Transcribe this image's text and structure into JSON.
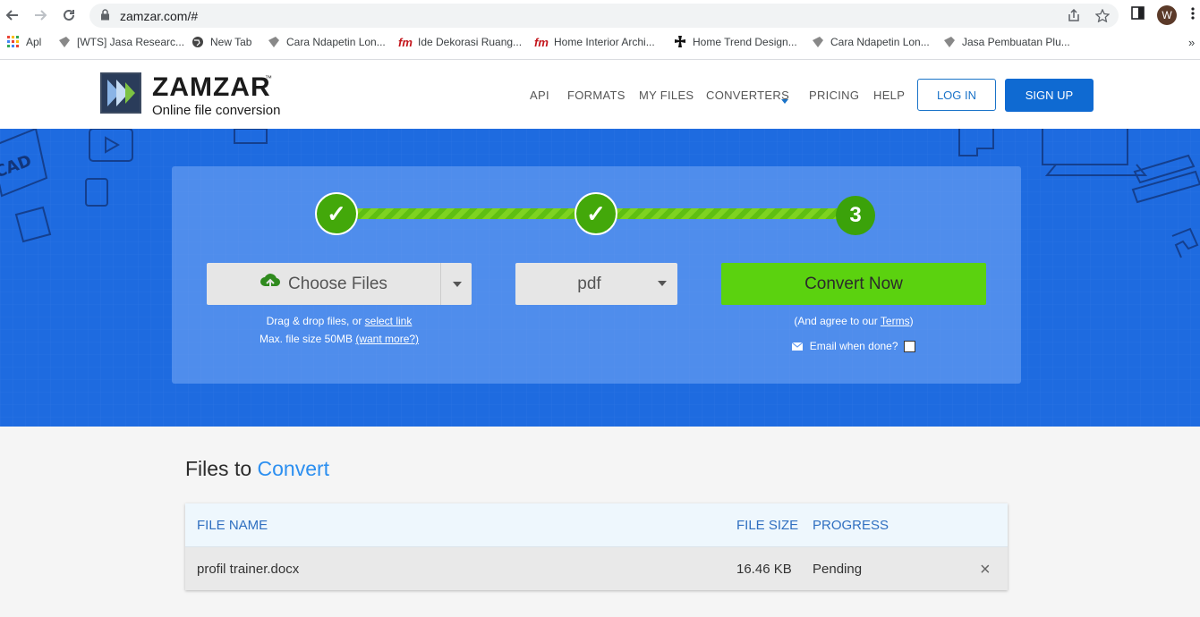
{
  "browser": {
    "url": "zamzar.com/#",
    "avatar_letter": "W",
    "bookmarks": [
      {
        "label": "Apl",
        "icon": "apps-grid-icon"
      },
      {
        "label": "[WTS] Jasa Researc...",
        "icon": "bookmark-site-icon"
      },
      {
        "label": "New Tab",
        "icon": "globe-icon"
      },
      {
        "label": "Cara Ndapetin Lon...",
        "icon": "bookmark-site-icon"
      },
      {
        "label": "Ide Dekorasi Ruang...",
        "icon": "fm-icon"
      },
      {
        "label": "Home Interior Archi...",
        "icon": "fm-icon"
      },
      {
        "label": "Home Trend Design...",
        "icon": "cross-icon"
      },
      {
        "label": "Cara Ndapetin Lon...",
        "icon": "bookmark-site-icon"
      },
      {
        "label": "Jasa Pembuatan Plu...",
        "icon": "bookmark-site-icon"
      }
    ],
    "more_bookmarks": "»"
  },
  "header": {
    "logo_word": "ZAMZAR",
    "logo_tm": "™",
    "logo_sub": "Online file conversion",
    "nav": [
      "API",
      "FORMATS",
      "MY FILES",
      "CONVERTERS",
      "PRICING",
      "HELP"
    ],
    "login_label": "LOG IN",
    "signup_label": "SIGN UP"
  },
  "converter": {
    "step1_mark": "✓",
    "step2_mark": "✓",
    "step3_label": "3",
    "choose_files_label": "Choose Files",
    "drag_text": "Drag & drop files, or ",
    "select_link": "select link",
    "max_size_text": "Max. file size 50MB ",
    "want_more": "(want more?)",
    "format_value": "pdf",
    "convert_label": "Convert Now",
    "agree_text": "(And agree to our ",
    "terms_link": "Terms",
    "agree_close": ")",
    "email_label": "Email when done?",
    "hero_deco_text": "CAD"
  },
  "files": {
    "title_plain": "Files to ",
    "title_accent": "Convert",
    "headers": {
      "name": "FILE NAME",
      "size": "FILE SIZE",
      "progress": "PROGRESS"
    },
    "rows": [
      {
        "name": "profil trainer.docx",
        "size": "16.46 KB",
        "progress": "Pending"
      }
    ],
    "remove_symbol": "×"
  },
  "colors": {
    "hero_blue": "#1e6be0",
    "step_green": "#43a80a",
    "convert_green": "#5bd20f",
    "signup_blue": "#0f6ad2",
    "accent_blue": "#2c8ff0"
  }
}
